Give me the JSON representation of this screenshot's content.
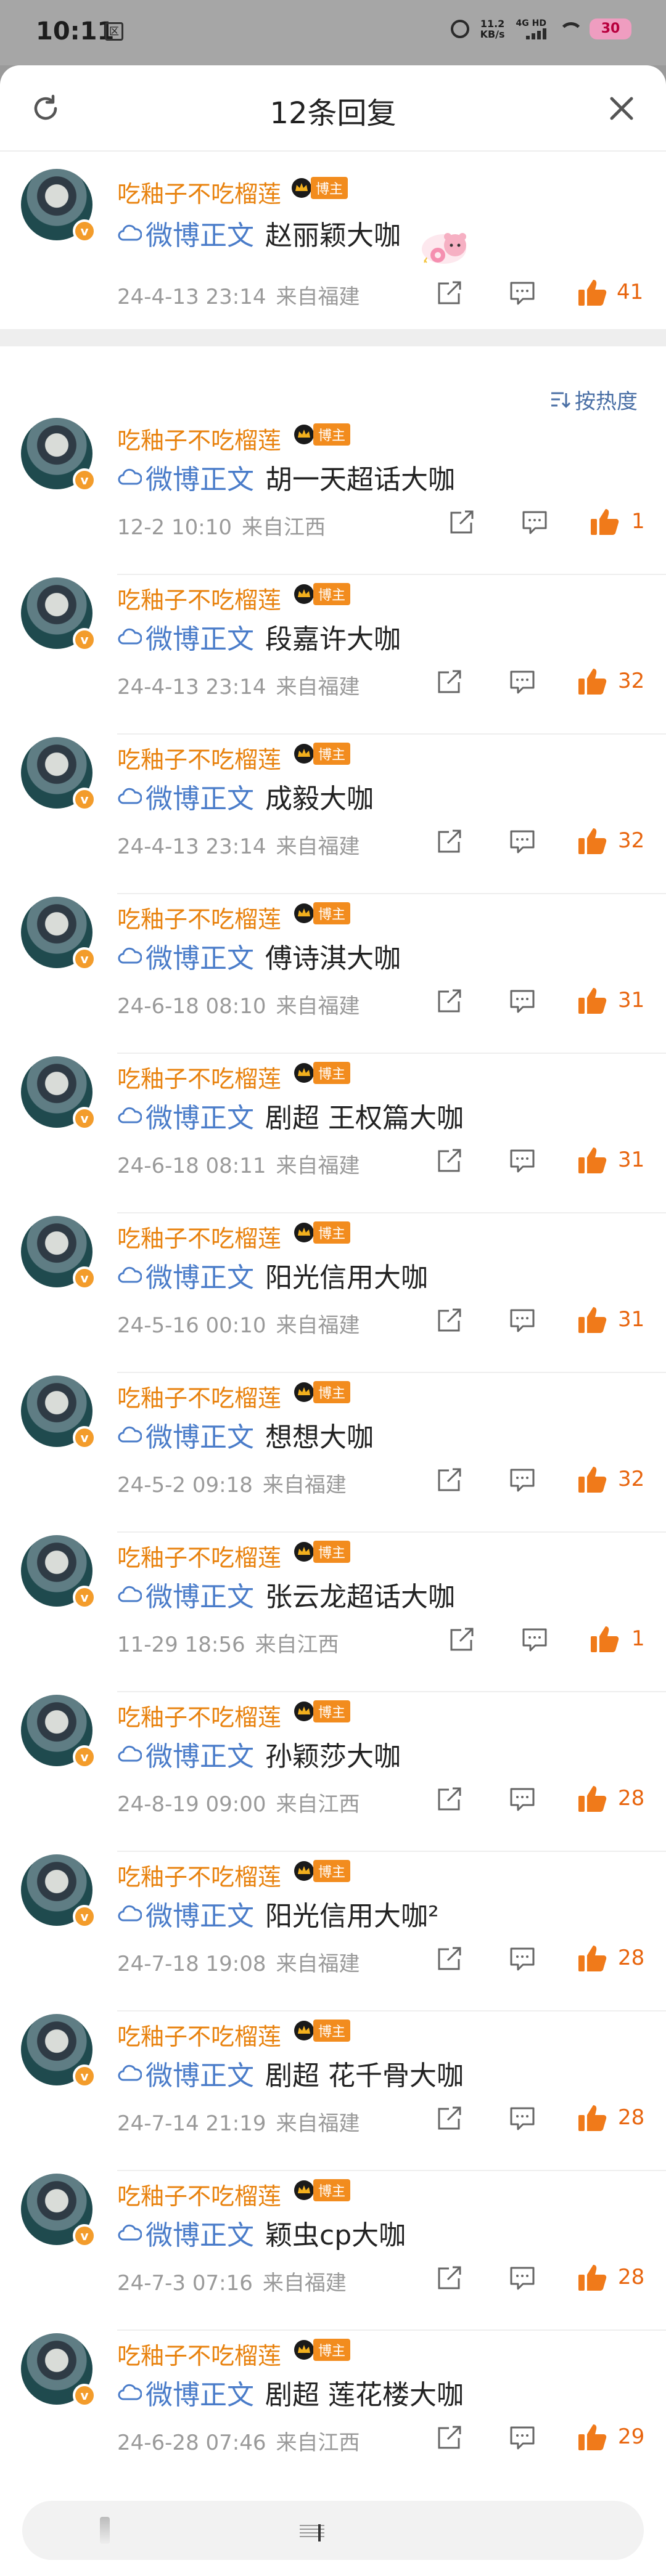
{
  "status_bar": {
    "time": "10:11",
    "notification_glyph": "区",
    "net_speed_value": "11.2",
    "net_speed_unit": "KB/s",
    "network": "4G HD",
    "battery": "30"
  },
  "header": {
    "title": "12条回复",
    "refresh_icon": "refresh-icon",
    "close_icon": "close-icon"
  },
  "colors": {
    "username": "#e8820e",
    "link": "#4a7cc9",
    "like": "#f07a1a",
    "meta": "#9a9a9a"
  },
  "user": {
    "name": "吃釉子不吃榴莲",
    "badge": "博主"
  },
  "root_comment": {
    "link_label": "微博正文",
    "text": "赵丽颖大咖",
    "time": "24-4-13 23:14",
    "location": "来自福建",
    "likes": "41"
  },
  "sort_label": "按热度",
  "replies": [
    {
      "link_label": "微博正文",
      "text": "胡一天超话大咖",
      "time": "12-2 10:10",
      "location": "来自江西",
      "likes": "1"
    },
    {
      "link_label": "微博正文",
      "text": "段嘉许大咖",
      "time": "24-4-13 23:14",
      "location": "来自福建",
      "likes": "32"
    },
    {
      "link_label": "微博正文",
      "text": "成毅大咖",
      "time": "24-4-13 23:14",
      "location": "来自福建",
      "likes": "32"
    },
    {
      "link_label": "微博正文",
      "text": "傅诗淇大咖",
      "time": "24-6-18 08:10",
      "location": "来自福建",
      "likes": "31"
    },
    {
      "link_label": "微博正文",
      "text": "剧超 王权篇大咖",
      "time": "24-6-18 08:11",
      "location": "来自福建",
      "likes": "31"
    },
    {
      "link_label": "微博正文",
      "text": "阳光信用大咖",
      "time": "24-5-16 00:10",
      "location": "来自福建",
      "likes": "31"
    },
    {
      "link_label": "微博正文",
      "text": "想想大咖",
      "time": "24-5-2 09:18",
      "location": "来自福建",
      "likes": "32"
    },
    {
      "link_label": "微博正文",
      "text": "张云龙超话大咖",
      "time": "11-29 18:56",
      "location": "来自江西",
      "likes": "1"
    },
    {
      "link_label": "微博正文",
      "text": "孙颖莎大咖",
      "time": "24-8-19 09:00",
      "location": "来自江西",
      "likes": "28"
    },
    {
      "link_label": "微博正文",
      "text": "阳光信用大咖²",
      "time": "24-7-18 19:08",
      "location": "来自福建",
      "likes": "28"
    },
    {
      "link_label": "微博正文",
      "text": "剧超 花千骨大咖",
      "time": "24-7-14 21:19",
      "location": "来自福建",
      "likes": "28"
    },
    {
      "link_label": "微博正文",
      "text": "颖虫cp大咖",
      "time": "24-7-3 07:16",
      "location": "来自福建",
      "likes": "28"
    },
    {
      "link_label": "微博正文",
      "text": "剧超 莲花楼大咖",
      "time": "24-6-28 07:46",
      "location": "来自江西",
      "likes": "29"
    }
  ]
}
